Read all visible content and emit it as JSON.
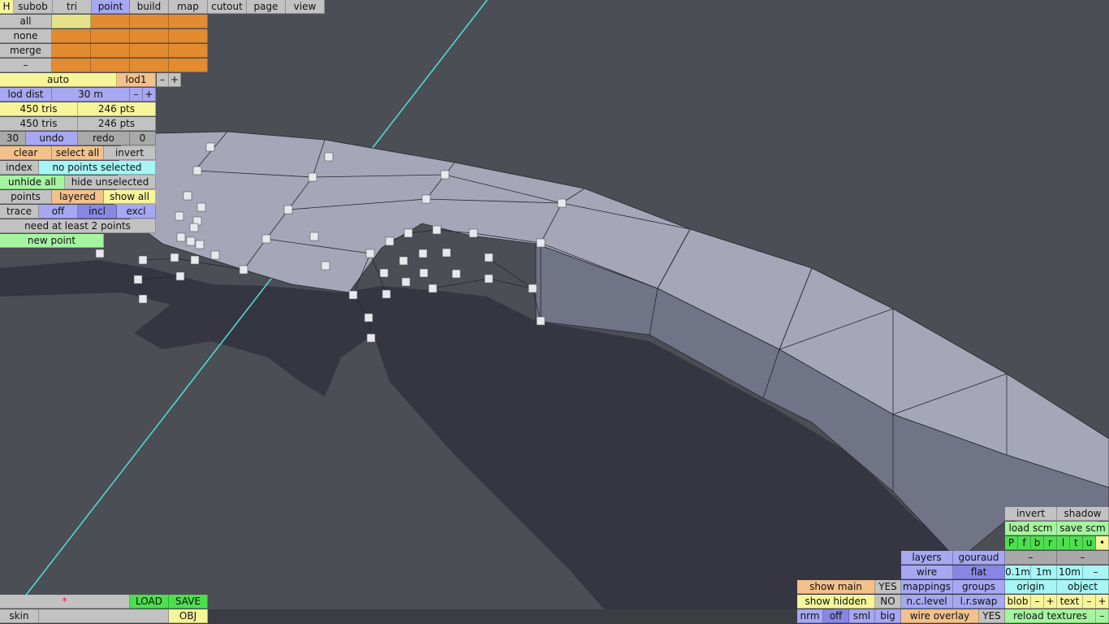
{
  "menu": [
    "H",
    "subob",
    "tri",
    "point",
    "build",
    "map",
    "cutout",
    "page",
    "view"
  ],
  "sel": {
    "all": "all",
    "none": "none",
    "merge": "merge",
    "dash": "–"
  },
  "lod": {
    "auto": "auto",
    "lod1": "lod1",
    "minus": "–",
    "plus": "+",
    "dist_label": "lod dist",
    "dist_value": "30 m"
  },
  "stats": {
    "tris1": "450 tris",
    "pts1": "246 pts",
    "tris2": "450 tris",
    "pts2": "246 pts"
  },
  "hist": {
    "count": "30",
    "undo": "undo",
    "redo": "redo",
    "redo_count": "0"
  },
  "selection": {
    "clear": "clear",
    "select_all": "select all",
    "invert": "invert"
  },
  "index": {
    "label": "index",
    "status": "no points selected"
  },
  "hide": {
    "unhide_all": "unhide all",
    "hide_unselected": "hide unselected"
  },
  "points": {
    "label": "points",
    "layered": "layered",
    "show_all": "show all"
  },
  "trace": {
    "label": "trace",
    "off": "off",
    "incl": "incl",
    "excl": "excl"
  },
  "message": "need at least 2 points",
  "new_point": "new point",
  "file": {
    "star": "*",
    "load": "LOAD",
    "save": "SAVE",
    "skin": "skin",
    "obj": "OBJ"
  },
  "view": {
    "invert": "invert",
    "shadow": "shadow",
    "load_scm": "load scm",
    "save_scm": "save scm",
    "flags": [
      "P",
      "f",
      "b",
      "r",
      "l",
      "t",
      "u",
      "•"
    ],
    "dash": "–",
    "layers": "layers",
    "gouraud": "gouraud",
    "wire": "wire",
    "flat": "flat",
    "s01": "0.1m",
    "s1": "1m",
    "s10": "10m",
    "mappings": "mappings",
    "groups": "groups",
    "origin": "origin",
    "object": "object",
    "nc_level": "n.c.level",
    "lr_swap": "l.r.swap",
    "blob": "blob",
    "text": "text",
    "minus": "–",
    "plus": "+",
    "show_main": "show main",
    "show_main_val": "YES",
    "show_hidden": "show hidden",
    "show_hidden_val": "NO",
    "nrm": "nrm",
    "off": "off",
    "sml": "sml",
    "big": "big",
    "wire_overlay": "wire overlay",
    "wire_overlay_val": "YES",
    "reload_textures": "reload textures"
  }
}
